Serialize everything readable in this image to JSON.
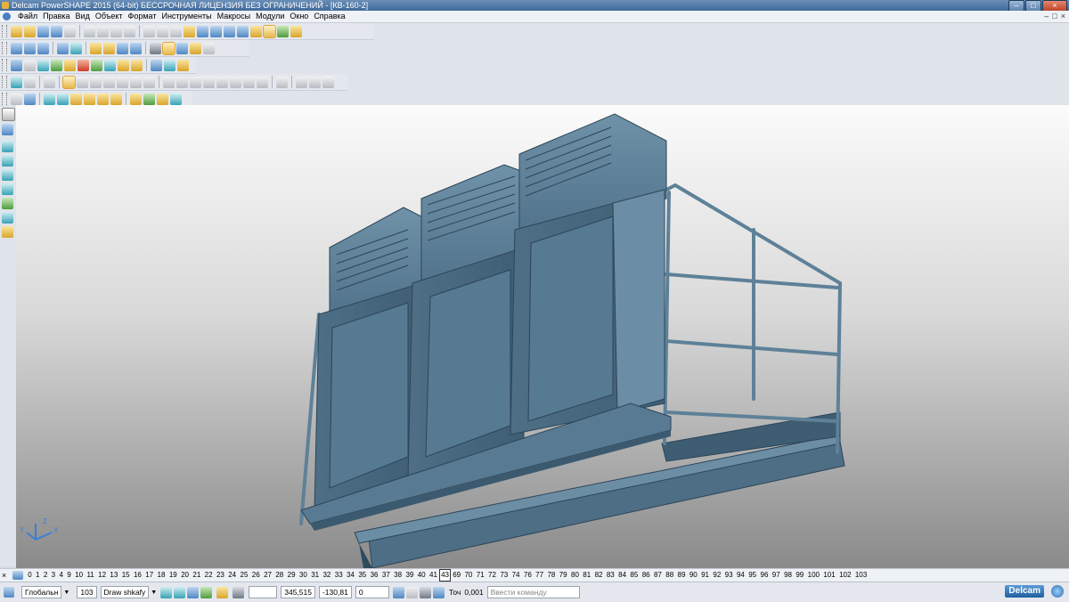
{
  "window": {
    "title": "Delcam PowerSHAPE 2015 (64-bit) БЕССРОЧНАЯ ЛИЦЕНЗИЯ БЕЗ ОГРАНИЧЕНИЙ - [КВ-160-2]",
    "buttons": {
      "minimize": "–",
      "maximize": "□",
      "close": "×"
    }
  },
  "menu": {
    "items": [
      "Файл",
      "Правка",
      "Вид",
      "Объект",
      "Формат",
      "Инструменты",
      "Макросы",
      "Модули",
      "Окно",
      "Справка"
    ],
    "mdi": {
      "minimize": "–",
      "restore": "□",
      "close": "×"
    }
  },
  "toolbars": {
    "row1": [
      "new-file-icon",
      "open-file-icon",
      "open-recent-icon",
      "save-icon",
      "print-icon",
      "cut-icon",
      "copy-icon",
      "paste-icon",
      "delete-icon",
      "undo-icon",
      "redo-icon",
      "select-icon",
      "surface-icon",
      "line-icon",
      "arc-icon",
      "circle-icon",
      "curve-icon",
      "workplane-icon",
      "solid-icon",
      "shade-icon",
      "tools-icon"
    ],
    "row2": [
      "view-iso-icon",
      "view-top-icon",
      "view-front-icon",
      "view-side-icon",
      "zoom-in-icon",
      "zoom-out-icon",
      "zoom-box-icon",
      "zoom-fit-icon",
      "globe-icon",
      "shaded-icon",
      "light-icon"
    ],
    "row3": [
      "layer-icon",
      "document-icon",
      "render-icon",
      "sphere-green-icon",
      "sphere-red-icon",
      "play-icon",
      "next-icon",
      "cube-icon",
      "box-icon",
      "measure-icon",
      "transform-icon"
    ],
    "row4": [
      "grid-icon",
      "filter-icon",
      "view-a-icon",
      "view-b-icon",
      "view-c-icon",
      "view-d-icon",
      "view-e-icon",
      "view-f-icon"
    ],
    "row5": [
      "snap-icon",
      "axis-icon",
      "part-a-icon",
      "part-b-icon",
      "part-c-icon",
      "part-d-icon",
      "part-e-icon",
      "part-f-icon",
      "part-g-icon",
      "part-h-icon",
      "part-i-icon"
    ]
  },
  "levels": {
    "items": [
      "0",
      "1",
      "2",
      "3",
      "4",
      "9",
      "10",
      "11",
      "12",
      "13",
      "15",
      "16",
      "17",
      "18",
      "19",
      "20",
      "21",
      "22",
      "23",
      "24",
      "25",
      "26",
      "27",
      "28",
      "29",
      "30",
      "31",
      "32",
      "33",
      "34",
      "35",
      "36",
      "37",
      "38",
      "39",
      "40",
      "41",
      "43",
      "69",
      "70",
      "71",
      "72",
      "73",
      "74",
      "76",
      "77",
      "78",
      "79",
      "80",
      "81",
      "82",
      "83",
      "84",
      "85",
      "86",
      "87",
      "88",
      "89",
      "90",
      "91",
      "92",
      "93",
      "94",
      "95",
      "96",
      "97",
      "98",
      "99",
      "100",
      "101",
      "102",
      "103"
    ],
    "active": "43"
  },
  "status": {
    "workplane": "Глобальн",
    "level_number": "103",
    "level_name": "Draw shkafy",
    "x": "345,515",
    "y": "-130,81",
    "z": "0",
    "tolerance_label": "Точ",
    "tolerance": "0,001",
    "command_placeholder": "Ввести команду",
    "brand": "Delcam"
  },
  "viewport": {
    "model_color": "#5b7d94",
    "axis_labels": {
      "x": "X",
      "y": "Y",
      "z": "Z"
    }
  }
}
